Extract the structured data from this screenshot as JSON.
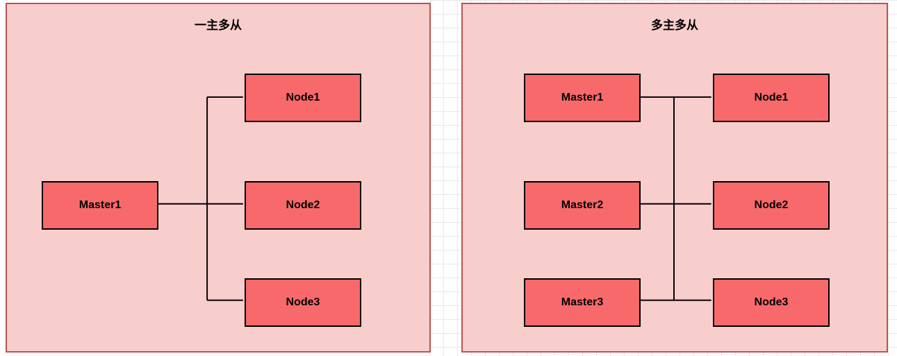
{
  "colors": {
    "panelBg": "#f8cecc",
    "panelBorder": "#b85450",
    "boxBg": "#f8696b",
    "boxBorder": "#000000",
    "connector": "#000000"
  },
  "leftPanel": {
    "title": "一主多从",
    "master": {
      "label": "Master1"
    },
    "nodes": [
      {
        "label": "Node1"
      },
      {
        "label": "Node2"
      },
      {
        "label": "Node3"
      }
    ]
  },
  "rightPanel": {
    "title": "多主多从",
    "masters": [
      {
        "label": "Master1"
      },
      {
        "label": "Master2"
      },
      {
        "label": "Master3"
      }
    ],
    "nodes": [
      {
        "label": "Node1"
      },
      {
        "label": "Node2"
      },
      {
        "label": "Node3"
      }
    ]
  }
}
